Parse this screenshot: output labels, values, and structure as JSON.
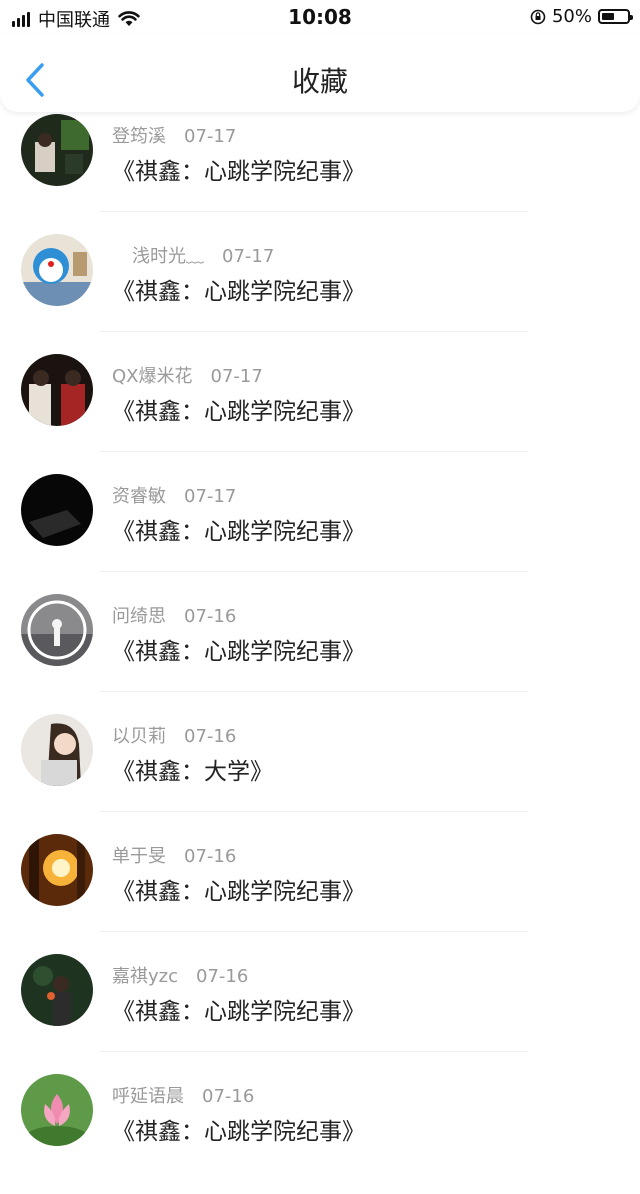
{
  "status_bar": {
    "carrier": "中国联通",
    "time": "10:08",
    "battery_percent": "50%",
    "battery_level": 0.5,
    "icons": [
      "signal-icon",
      "wifi-icon",
      "orientation-lock-icon",
      "battery-icon"
    ]
  },
  "nav": {
    "title": "收藏",
    "back_icon": "chevron-left-icon",
    "accent_color": "#3a9ff0"
  },
  "items": [
    {
      "author": "登筠溪",
      "date": "07-17",
      "title": "《祺鑫：心跳学院纪事》"
    },
    {
      "author": "浅时光﹏",
      "date": "07-17",
      "title": "《祺鑫：心跳学院纪事》"
    },
    {
      "author": "QX爆米花",
      "date": "07-17",
      "title": "《祺鑫：心跳学院纪事》"
    },
    {
      "author": "资睿敏",
      "date": "07-17",
      "title": "《祺鑫：心跳学院纪事》"
    },
    {
      "author": "问绮思",
      "date": "07-16",
      "title": "《祺鑫：心跳学院纪事》"
    },
    {
      "author": "以贝莉",
      "date": "07-16",
      "title": "《祺鑫：大学》"
    },
    {
      "author": "单于旻",
      "date": "07-16",
      "title": "《祺鑫：心跳学院纪事》"
    },
    {
      "author": "嘉祺yzc",
      "date": "07-16",
      "title": "《祺鑫：心跳学院纪事》"
    },
    {
      "author": "呼延语晨",
      "date": "07-16",
      "title": "《祺鑫：心跳学院纪事》"
    }
  ]
}
